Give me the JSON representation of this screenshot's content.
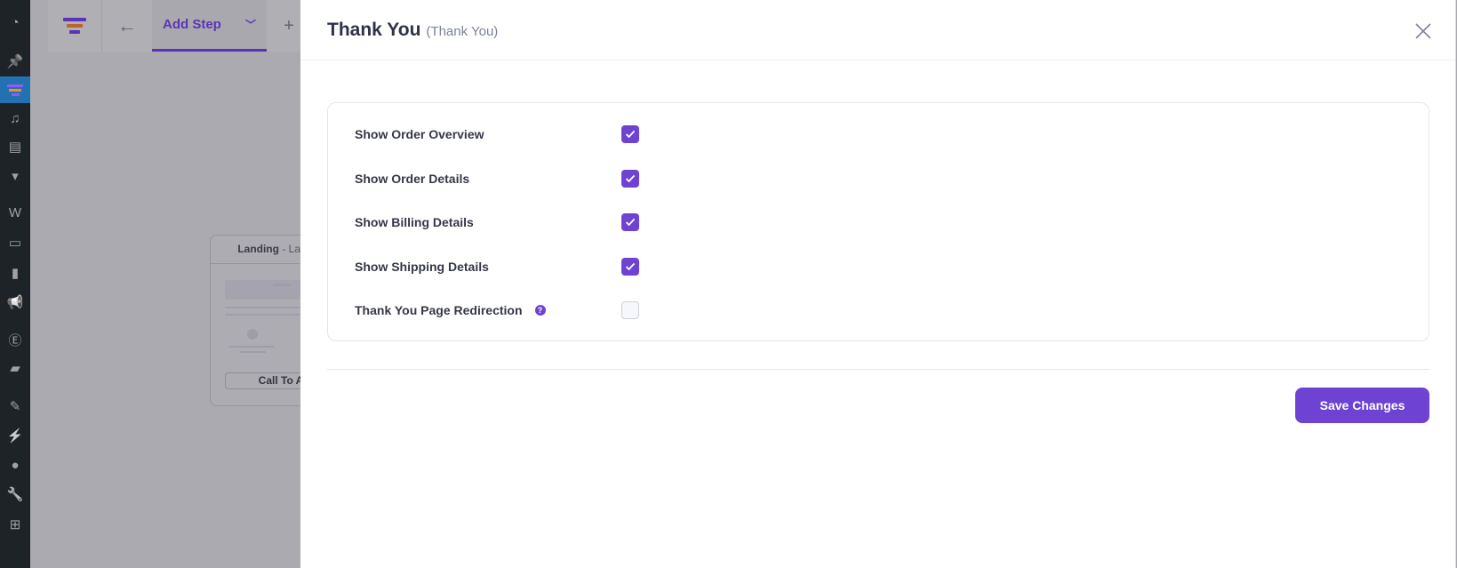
{
  "wp_sidebar": {
    "icons": [
      "dashboard-icon",
      "pin-icon",
      "funnel-icon",
      "media-icon",
      "pages-icon",
      "comments-icon",
      "woo-icon",
      "products-icon",
      "analytics-icon",
      "marketing-icon",
      "elementor-icon",
      "folder-icon",
      "appearance-icon",
      "plugins-icon",
      "users-icon",
      "tools-icon",
      "settings-icon"
    ],
    "active": "funnel-icon"
  },
  "topbar": {
    "tab_label": "Add Step"
  },
  "canvas": {
    "card_title": "Landing",
    "card_subtitle": "- Lan",
    "card_button": "Call To Acti"
  },
  "modal": {
    "title": "Thank You",
    "subtitle": "(Thank You)",
    "settings": [
      {
        "label": "Show Order Overview",
        "checked": true
      },
      {
        "label": "Show Order Details",
        "checked": true
      },
      {
        "label": "Show Billing Details",
        "checked": true
      },
      {
        "label": "Show Shipping Details",
        "checked": true
      },
      {
        "label": "Thank You Page Redirection",
        "checked": false,
        "help": true
      }
    ],
    "save_label": "Save Changes"
  },
  "colors": {
    "accent": "#6e42d3",
    "wp_sidebar": "#1d2327",
    "wp_active": "#2271b1"
  }
}
